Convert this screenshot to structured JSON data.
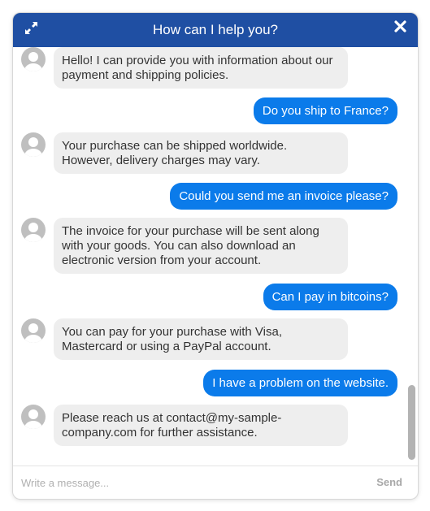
{
  "header": {
    "title": "How can I help you?",
    "expand_icon": "expand-arrows-icon",
    "close_icon": "close-x-icon"
  },
  "messages": [
    {
      "from": "bot",
      "text": "Hello! I can provide you with information about our payment and shipping policies."
    },
    {
      "from": "user",
      "text": "Do you ship to France?"
    },
    {
      "from": "bot",
      "text": "Your purchase can be shipped worldwide. However, delivery charges may vary."
    },
    {
      "from": "user",
      "text": "Could you send me an invoice please?"
    },
    {
      "from": "bot",
      "text": "The invoice for your purchase will be sent along with your goods. You can also download an electronic version from your account."
    },
    {
      "from": "user",
      "text": "Can I pay in bitcoins?"
    },
    {
      "from": "bot",
      "text": "You can pay for your purchase with Visa, Mastercard or using a PayPal account."
    },
    {
      "from": "user",
      "text": "I have a problem on the website."
    },
    {
      "from": "bot",
      "text": "Please reach us at contact@my-sample-company.com for further assistance."
    }
  ],
  "composer": {
    "placeholder": "Write a message...",
    "send_label": "Send"
  },
  "colors": {
    "header": "#1f4fa3",
    "user_bubble": "#0b7bea",
    "bot_bubble": "#eeeeee"
  }
}
